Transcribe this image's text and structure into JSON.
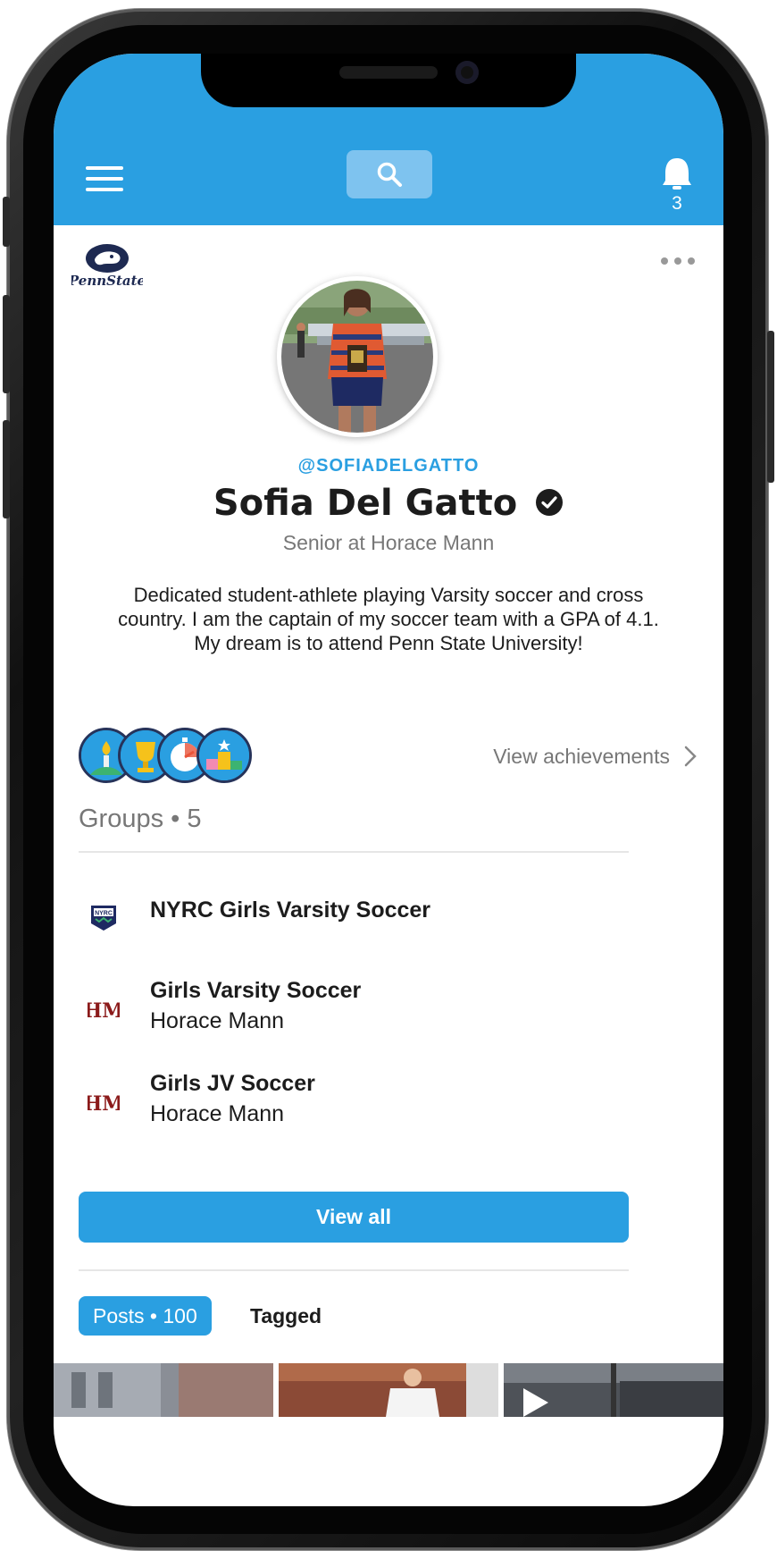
{
  "header": {
    "notification_count": "3",
    "colors": {
      "accent": "#2a9fe1"
    }
  },
  "profile": {
    "school_logo_text": "PennState",
    "handle": "@SOFIADELGATTO",
    "name": "Sofia Del Gatto",
    "subtitle": "Senior at Horace Mann",
    "bio": "Dedicated student-athlete playing Varsity soccer and cross country. I am the captain of my soccer team with a GPA of 4.1. My dream is to attend Penn State University!"
  },
  "achievements": {
    "badges": [
      "torch-badge",
      "trophy-badge",
      "stopwatch-badge",
      "podium-badge"
    ],
    "link_label": "View achievements"
  },
  "groups": {
    "title": "Groups • 5",
    "items": [
      {
        "name": "NYRC Girls Varsity Soccer",
        "sub": "",
        "icon": "nyrc-logo"
      },
      {
        "name": "Girls Varsity Soccer",
        "sub": "Horace Mann",
        "icon": "horace-mann-logo"
      },
      {
        "name": "Girls JV Soccer",
        "sub": "Horace Mann",
        "icon": "horace-mann-logo"
      }
    ],
    "view_all_label": "View all"
  },
  "tabs": {
    "posts_label": "Posts • 100",
    "tagged_label": "Tagged"
  }
}
